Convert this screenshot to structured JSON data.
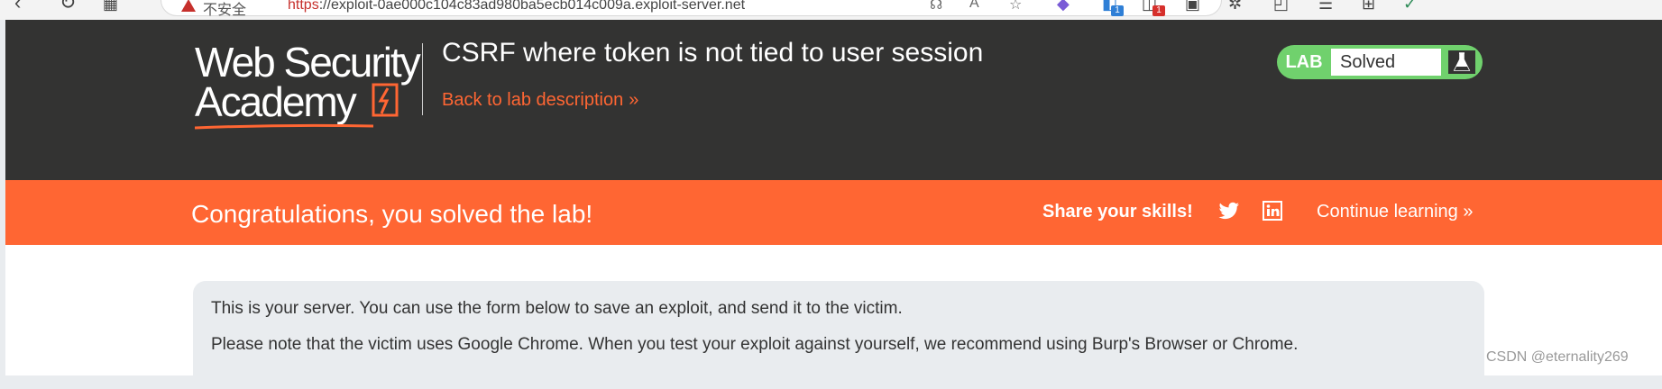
{
  "browser": {
    "not_secure": "不安全",
    "url_scheme": "https",
    "url_rest": "://exploit-0ae000c104c83ad980ba5ecb014c009a.exploit-server.net",
    "badge_a": "1",
    "badge_b": "1"
  },
  "header": {
    "logo_line1": "Web Security",
    "logo_line2": "Academy",
    "lab_title": "CSRF where token is not tied to user session",
    "back_link": "Back to lab description",
    "lab_label": "LAB",
    "lab_status": "Solved"
  },
  "banner": {
    "congrats": "Congratulations, you solved the lab!",
    "share": "Share your skills!",
    "continue": "Continue learning"
  },
  "info": {
    "line1": "This is your server. You can use the form below to save an exploit, and send it to the victim.",
    "line2": "Please note that the victim uses Google Chrome. When you test your exploit against yourself, we recommend using Burp's Browser or Chrome."
  },
  "watermark": "CSDN @eternality269",
  "colors": {
    "header_bg": "#333332",
    "accent_orange": "#ff6633",
    "solved_green": "#70d16d",
    "info_bg": "#e9ecef"
  }
}
